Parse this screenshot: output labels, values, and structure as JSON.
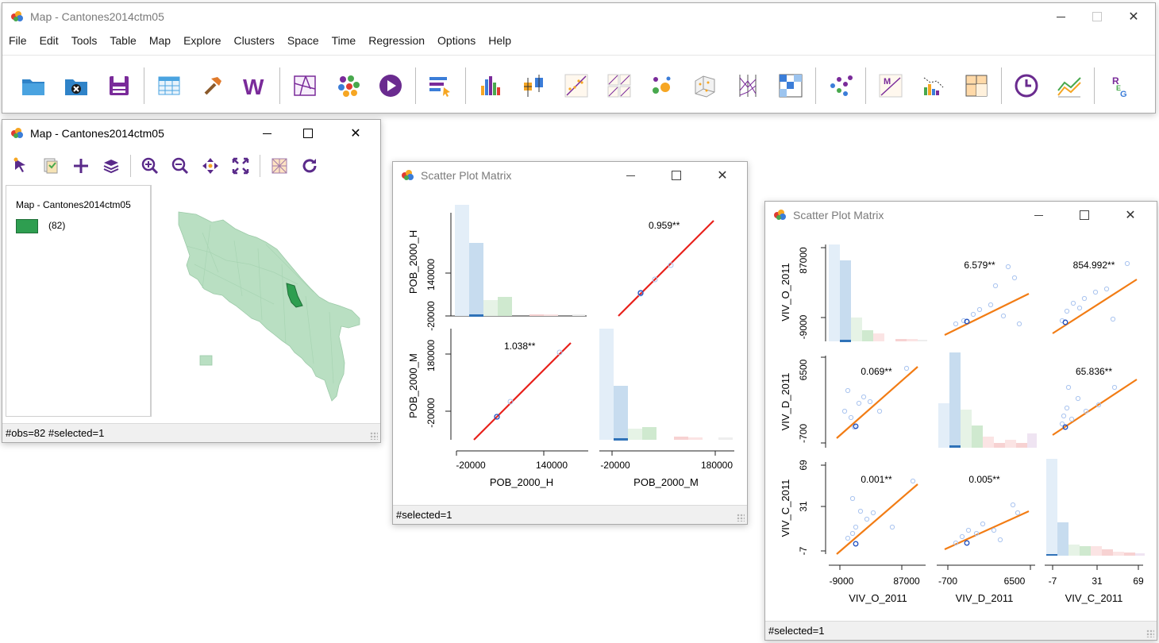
{
  "main_window": {
    "title": "Map - Cantones2014ctm05",
    "menu": [
      "File",
      "Edit",
      "Tools",
      "Table",
      "Map",
      "Explore",
      "Clusters",
      "Space",
      "Time",
      "Regression",
      "Options",
      "Help"
    ]
  },
  "map_window": {
    "title": "Map - Cantones2014ctm05",
    "legend_title": "Map - Cantones2014ctm05",
    "legend_count": "(82)",
    "status": "#obs=82 #selected=1",
    "colors": {
      "fill": "#b9dfc2",
      "selected": "#2e9e50",
      "border": "#9ccaa8"
    }
  },
  "spm1": {
    "title": "Scatter Plot Matrix",
    "status": "#selected=1",
    "vars": [
      "POB_2000_H",
      "POB_2000_M"
    ],
    "ticks": {
      "POB_2000_H": [
        "-20000",
        "140000"
      ],
      "POB_2000_M": [
        "-20000",
        "180000"
      ]
    },
    "coefs": [
      "0.959**",
      "1.038**"
    ]
  },
  "spm2": {
    "title": "Scatter Plot Matrix",
    "status": "#selected=1",
    "vars": [
      "VIV_O_2011",
      "VIV_D_2011",
      "VIV_C_2011"
    ],
    "ticks": {
      "VIV_O_2011": [
        "-9000",
        "87000"
      ],
      "VIV_D_2011": [
        "-700",
        "6500"
      ],
      "VIV_C_2011": [
        "-7",
        "31",
        "69"
      ]
    },
    "coefs": [
      "6.579**",
      "854.992**",
      "0.069**",
      "65.836**",
      "0.001**",
      "0.005**"
    ]
  }
}
